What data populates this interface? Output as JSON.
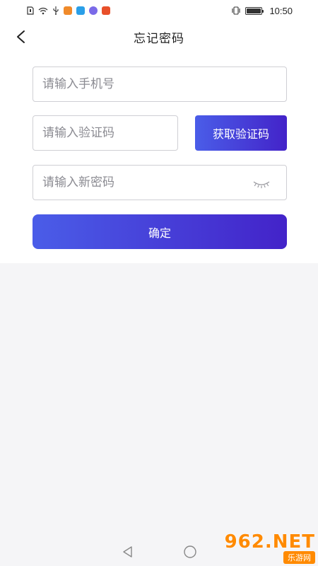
{
  "status_bar": {
    "time": "10:50",
    "icons": [
      "sim-icon",
      "wifi-icon",
      "usb-icon",
      "app-icon",
      "app-icon",
      "app-icon",
      "app-icon",
      "vibrate-icon",
      "battery-icon"
    ]
  },
  "header": {
    "title": "忘记密码",
    "back_icon": "chevron-left-icon"
  },
  "form": {
    "phone_placeholder": "请输入手机号",
    "code_placeholder": "请输入验证码",
    "get_code_label": "获取验证码",
    "password_placeholder": "请输入新密码",
    "eye_icon": "eye-closed-icon",
    "confirm_label": "确定"
  },
  "nav": {
    "icons": [
      "back-triangle-icon",
      "home-circle-icon"
    ]
  },
  "watermark": {
    "main": "962.NET",
    "sub": "乐游网"
  },
  "colors": {
    "accent_start": "#4a5de8",
    "accent_end": "#4323c9",
    "background": "#f5f5f7",
    "card": "#ffffff",
    "border": "#cfcfd4",
    "placeholder": "#8b8b92"
  }
}
